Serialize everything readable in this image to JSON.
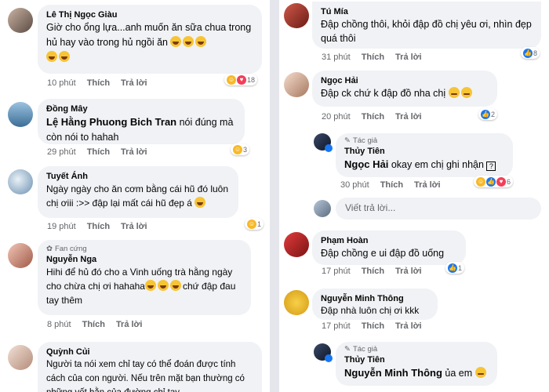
{
  "left": [
    {
      "author": "Lê Thị Ngọc Giàu",
      "text": "Giờ cho ổng lựa...anh muốn ăn sữa chua trong hủ hay vào  trong hủ ngồi ăn",
      "time": "10 phút",
      "react_count": "18"
    },
    {
      "author": "Đồng Mây",
      "mention": "Lệ Hằng Phuong Bich Tran",
      "text": " nói đúng mà còn nói to hahah",
      "time": "29 phút",
      "react_count": "3"
    },
    {
      "author": "Tuyết Ánh",
      "text": "Ngày ngày cho ăn cơm bằng cái hũ đó luôn chị ơiii :>> đập lại mất cái hũ đẹp á",
      "time": "19 phút",
      "react_count": "1"
    },
    {
      "badge": "Fan cứng",
      "author": "Nguyễn Nga",
      "text": "Hihi để hủ đó cho a Vinh uống trà hằng ngày cho chừa chị ơi hahaha",
      "text2": "chứ đập đau tay thêm",
      "time": "8 phút"
    },
    {
      "author": "Quỳnh Củi",
      "text": "Người ta nói xem chỉ tay có thể đoán được tính cách của con người. Nếu trên mặt bạn thường có những vết hằn của đường chỉ tay"
    }
  ],
  "right": [
    {
      "author": "Tú Mía",
      "text": "Đập chồng thôi, khỏi đập đồ chị yêu ơi, nhìn đẹp quá thôi",
      "time": "31 phút",
      "react_count": "8"
    },
    {
      "author": "Ngọc Hải",
      "text": "Đập ck chứ k đập đồ nha chị",
      "time": "20 phút",
      "react_count": "2"
    },
    {
      "badge": "Tác giả",
      "author": "Thủy Tiên",
      "mention": "Ngọc Hải",
      "text": " okay em chị ghi nhận",
      "qmark": "?",
      "time": "30 phút",
      "react_count": "6"
    },
    {
      "placeholder": "Viết trả lời..."
    },
    {
      "author": "Phạm Hoàn",
      "text": "Đập chồng e ui đập đồ uống",
      "time": "17 phút",
      "react_count": "1"
    },
    {
      "author": "Nguyễn Minh Thông",
      "text": "Đập nhà luôn chị ơi kkk",
      "time": "17 phút"
    },
    {
      "badge": "Tác giả",
      "author": "Thủy Tiên",
      "mention": "Nguyễn Minh Thông",
      "text": " ủa em"
    }
  ],
  "actions": {
    "like": "Thích",
    "reply": "Trả lời"
  }
}
